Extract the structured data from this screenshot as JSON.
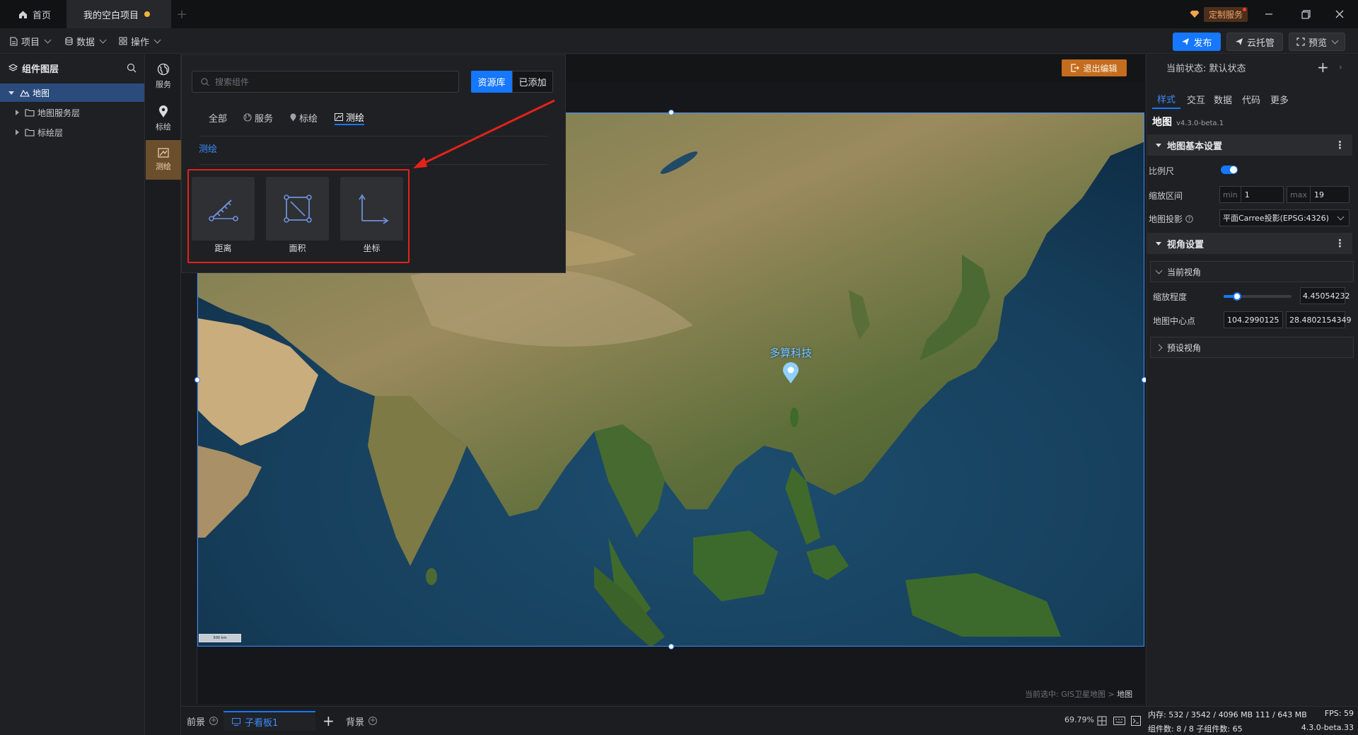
{
  "titlebar": {
    "home_tab": "首页",
    "project_tab": "我的空白项目",
    "custom_service": "定制服务"
  },
  "menubar": {
    "project": "项目",
    "data": "数据",
    "operate": "操作",
    "publish": "发布",
    "cloud_host": "云托管",
    "preview": "预览"
  },
  "layers": {
    "title": "组件图层",
    "items": [
      {
        "label": "地图",
        "selected": true
      },
      {
        "label": "地图服务层"
      },
      {
        "label": "标绘层"
      }
    ]
  },
  "rail": {
    "service": "服务",
    "marker": "标绘",
    "survey": "测绘"
  },
  "library": {
    "search_placeholder": "搜索组件",
    "seg_library": "资源库",
    "seg_added": "已添加",
    "tabs": [
      "全部",
      "服务",
      "标绘",
      "测绘"
    ],
    "active_tab": "测绘",
    "section_title": "测绘",
    "cards": [
      {
        "label": "距离",
        "icon": "ruler-icon"
      },
      {
        "label": "面积",
        "icon": "area-icon"
      },
      {
        "label": "坐标",
        "icon": "coordinate-axes-icon"
      }
    ]
  },
  "canvas": {
    "exit_edit": "退出编辑",
    "pin_label": "多算科技",
    "scale_text": "500 km",
    "selection_prefix": "当前选中: GIS卫星地图 > ",
    "selection_target": "地图"
  },
  "bottombar": {
    "foreground": "前景",
    "subboard": "子看板1",
    "background": "背景",
    "zoom": "69.79%"
  },
  "right_panel": {
    "state_label": "当前状态:  默认状态",
    "tabs": [
      "样式",
      "交互",
      "数据",
      "代码",
      "更多"
    ],
    "component_name": "地图",
    "component_version": "v4.3.0-beta.1",
    "section_basic": "地图基本设置",
    "scale_label": "比例尺",
    "scale_enabled": true,
    "zoom_range_label": "缩放区间",
    "zoom_min_prefix": "min",
    "zoom_min": "1",
    "zoom_max_prefix": "max",
    "zoom_max": "19",
    "projection_label": "地图投影",
    "projection_value": "平面Carree投影(EPSG:4326)",
    "section_view": "视角设置",
    "current_view": "当前视角",
    "zoom_degree_label": "缩放程度",
    "zoom_degree_value": "4.45054232",
    "zoom_slider_fraction": 0.2,
    "center_label": "地图中心点",
    "center_lng": "104.2990125",
    "center_lat": "28.4802154349",
    "preset_view": "预设视角"
  },
  "stats": {
    "memory": "内存:  532 / 3542 / 4096 MB   111 / 643 MB",
    "fps": "FPS:  59",
    "components": "组件数: 8 / 8   子组件数: 65",
    "version": "4.3.0-beta.33"
  },
  "colors": {
    "accent": "#1677ff",
    "highlight_red": "#e2231a",
    "exit_orange": "#c46d1f"
  }
}
